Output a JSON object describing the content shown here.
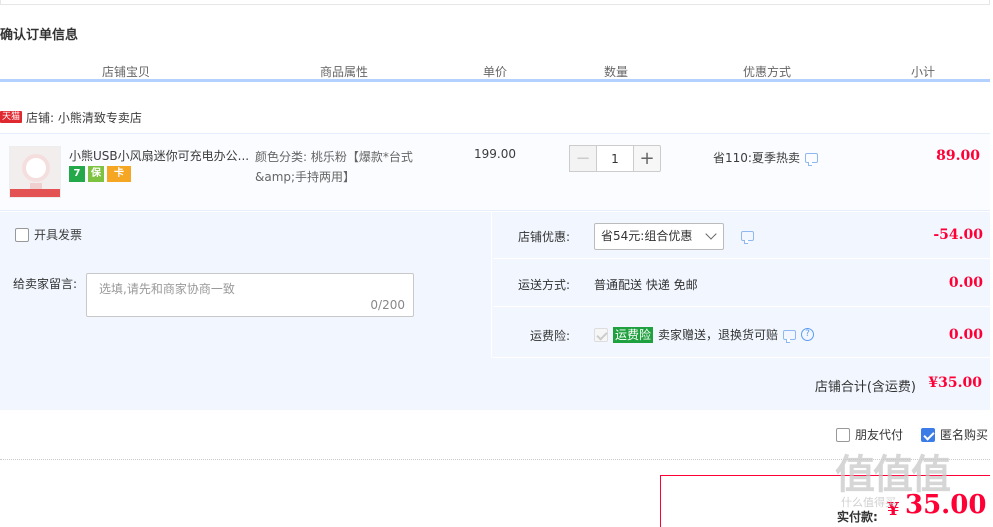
{
  "section_title": "确认订单信息",
  "columns": [
    "店铺宝贝",
    "商品属性",
    "单价",
    "数量",
    "优惠方式",
    "小计"
  ],
  "shop": {
    "badge": "天猫",
    "label": "店铺: 小熊清致专卖店"
  },
  "item": {
    "title": "小熊USB小风扇迷你可充电办公...",
    "service_icons": [
      "7",
      "保",
      "卡"
    ],
    "attr": "颜色分类: 桃乐粉【爆款*台式&amp;手持两用】",
    "price": "199.00",
    "qty_minus": "−",
    "qty": "1",
    "qty_plus": "+",
    "promo": "省110:夏季热卖",
    "subtotal": "89.00"
  },
  "invoice_label": "开具发票",
  "message": {
    "label": "给卖家留言:",
    "placeholder": "选填,请先和商家协商一致",
    "count": "0/200"
  },
  "discount": {
    "label": "店铺优惠:",
    "selected": "省54元:组合优惠",
    "value": "-54.00"
  },
  "shipping": {
    "label": "运送方式:",
    "method": "普通配送 快递 免邮",
    "value": "0.00"
  },
  "insurance": {
    "label": "运费险:",
    "badge": "运费险",
    "text": "卖家赠送，退换货可赔",
    "help": "?",
    "value": "0.00"
  },
  "shop_total": {
    "label": "店铺合计(含运费)",
    "value": "¥35.00"
  },
  "options": {
    "friend_pay": "朋友代付",
    "anonymous": "匿名购买"
  },
  "pay": {
    "label": "实付款:",
    "yen": "¥",
    "amount": "35.00"
  },
  "watermark": {
    "chars": "值值值",
    "sub": "什么值得买"
  },
  "colors": {
    "price_red": "#ff0036",
    "header_line": "#b2d1ff",
    "panel_bg": "#f2f7ff",
    "accent_blue": "#3b7ce6"
  }
}
